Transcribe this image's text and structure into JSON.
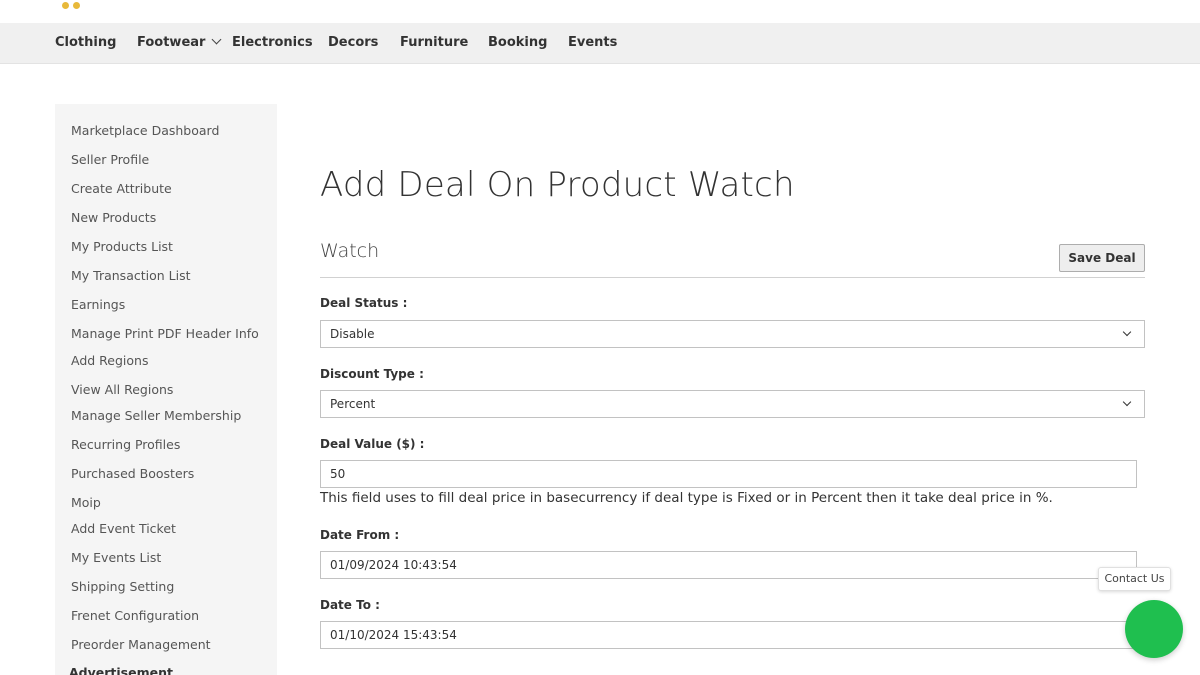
{
  "nav": {
    "items": [
      "Clothing",
      "Footwear",
      "Electronics",
      "Decors",
      "Furniture",
      "Booking",
      "Events"
    ]
  },
  "sidebar": {
    "items": [
      "Marketplace Dashboard",
      "Seller Profile",
      "Create Attribute",
      "New Products",
      "My Products List",
      "My Transaction List",
      "Earnings",
      "Manage Print PDF Header Info",
      "Add Regions",
      "View All Regions",
      "Manage Seller Membership",
      "Recurring Profiles",
      "Purchased Boosters",
      "Moip",
      "Add Event Ticket",
      "My Events List",
      "Shipping Setting",
      "Frenet Configuration",
      "Preorder Management"
    ],
    "heading": "Advertisement"
  },
  "page": {
    "title": "Add Deal On Product Watch",
    "section_title": "Watch",
    "save_label": "Save Deal"
  },
  "form": {
    "deal_status_label": "Deal Status :",
    "deal_status_value": "Disable",
    "discount_type_label": "Discount Type :",
    "discount_type_value": "Percent",
    "deal_value_label": "Deal Value ($) :",
    "deal_value": "50",
    "deal_value_hint": "This field uses to fill deal price in basecurrency if deal type is Fixed or in Percent then it take deal price in %.",
    "date_from_label": "Date From :",
    "date_from_value": "01/09/2024 10:43:54",
    "date_to_label": "Date To :",
    "date_to_value": "01/10/2024 15:43:54"
  },
  "contact": {
    "label": "Contact Us",
    "color": "#1fbf4f"
  }
}
